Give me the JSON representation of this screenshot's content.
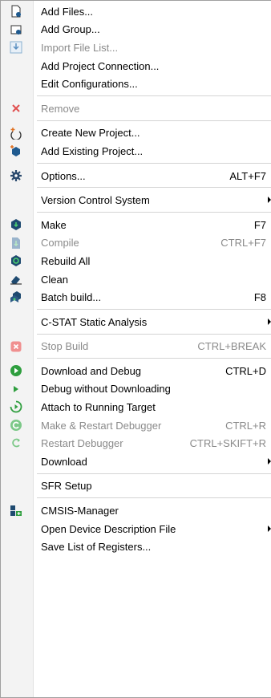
{
  "menu": {
    "add_files": "Add Files...",
    "add_group": "Add Group...",
    "import_file_list": "Import File List...",
    "add_project_connection": "Add Project Connection...",
    "edit_configurations": "Edit Configurations...",
    "remove": "Remove",
    "create_new_project": "Create New Project...",
    "add_existing_project": "Add Existing Project...",
    "options": "Options...",
    "options_shortcut": "ALT+F7",
    "version_control": "Version Control System",
    "make": "Make",
    "make_shortcut": "F7",
    "compile": "Compile",
    "compile_shortcut": "CTRL+F7",
    "rebuild_all": "Rebuild All",
    "clean": "Clean",
    "batch_build": "Batch build...",
    "batch_build_shortcut": "F8",
    "cstat": "C-STAT Static Analysis",
    "stop_build": "Stop Build",
    "stop_build_shortcut": "CTRL+BREAK",
    "download_and_debug": "Download and Debug",
    "download_and_debug_shortcut": "CTRL+D",
    "debug_without_downloading": "Debug without Downloading",
    "attach_to_running_target": "Attach to Running Target",
    "make_restart_debugger": "Make & Restart Debugger",
    "make_restart_debugger_shortcut": "CTRL+R",
    "restart_debugger": "Restart Debugger",
    "restart_debugger_shortcut": "CTRL+SKIFT+R",
    "download": "Download",
    "sfr_setup": "SFR Setup",
    "cmsis_manager": "CMSIS-Manager",
    "open_device_description": "Open Device Description File",
    "save_list_of_registers": "Save List of Registers..."
  },
  "colors": {
    "accent_green": "#2e9e3e",
    "accent_blue": "#1f5a8f",
    "remove_red": "#e05050",
    "disabled_text": "#8a8a8a"
  }
}
